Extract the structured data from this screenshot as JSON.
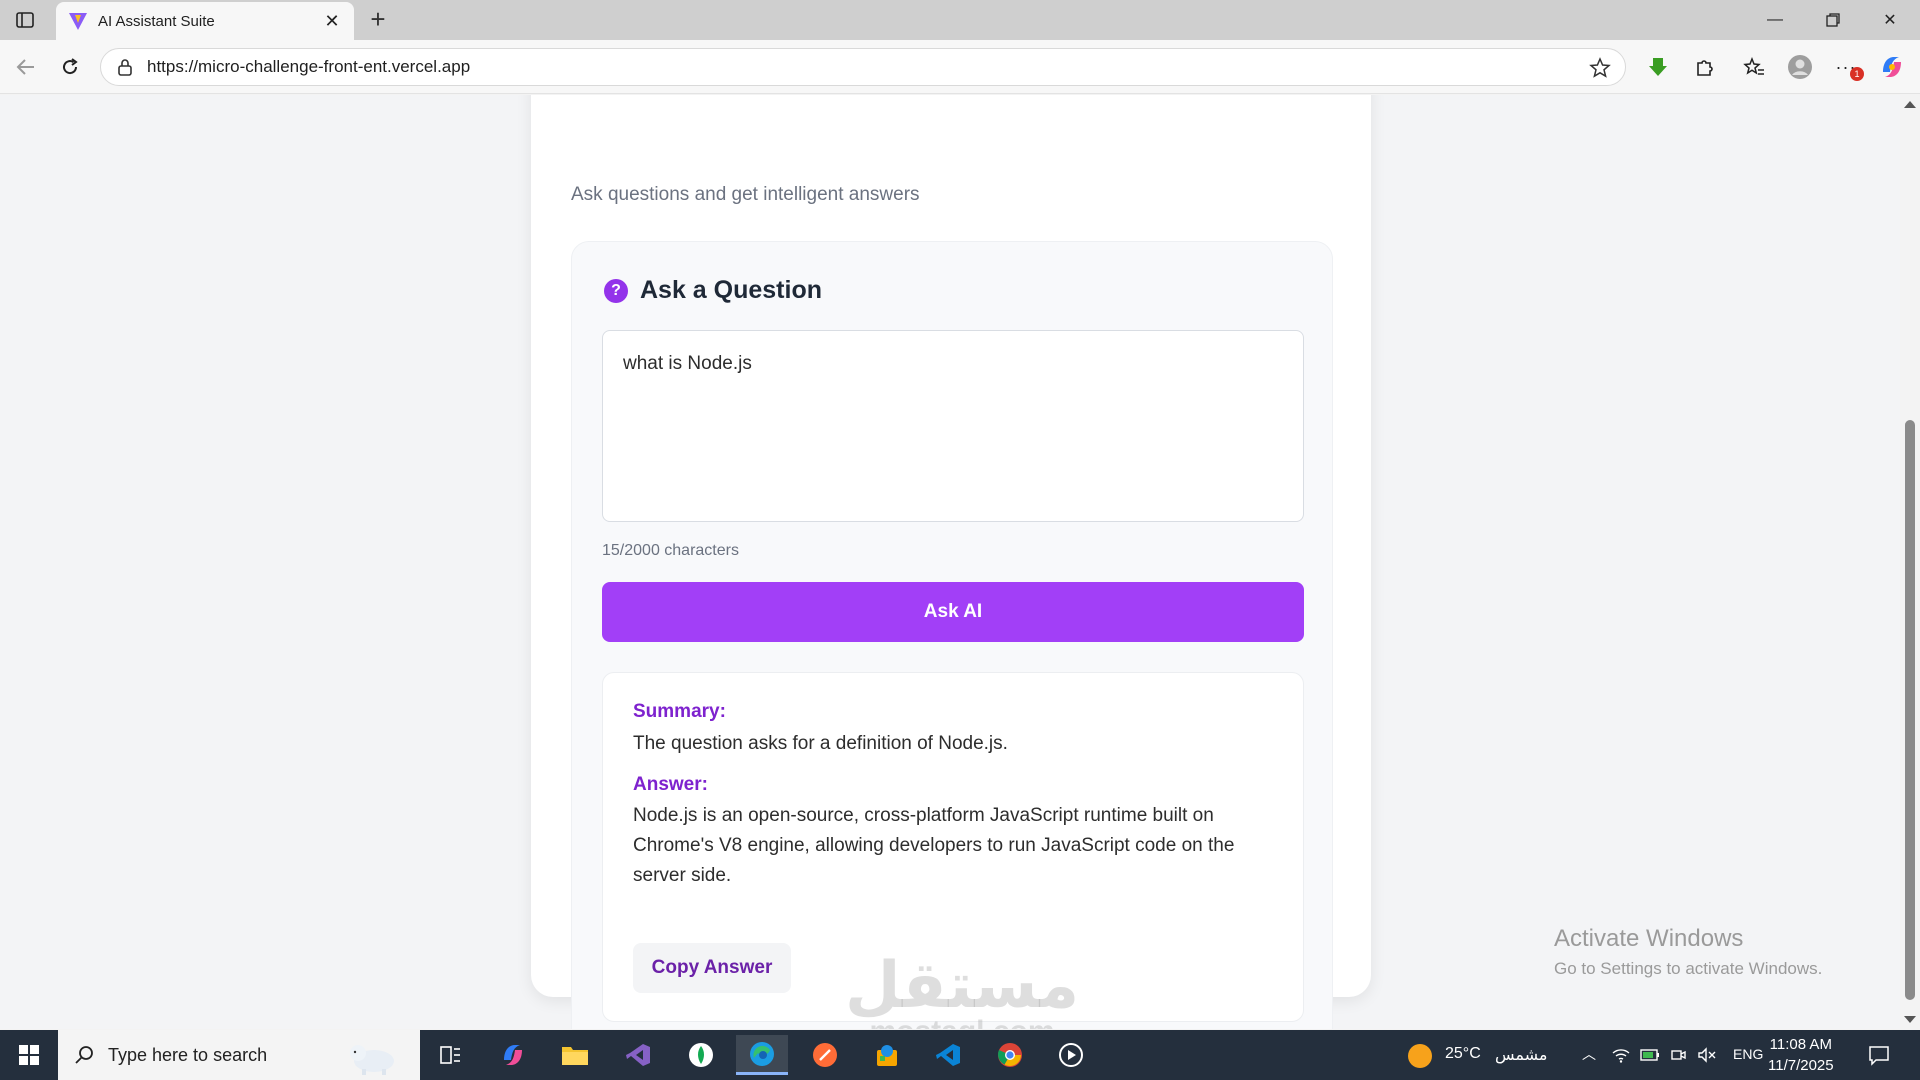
{
  "browser": {
    "tab_title": "AI Assistant Suite",
    "url": "https://micro-challenge-front-ent.vercel.app"
  },
  "page": {
    "subtitle": "Ask questions and get intelligent answers",
    "ask_title": "Ask a Question",
    "question_icon_glyph": "?",
    "question_value": "what is Node.js",
    "char_count": "15/2000 characters",
    "ask_button": "Ask AI",
    "summary_label": "Summary:",
    "summary_text": "The question asks for a definition of Node.js.",
    "answer_label": "Answer:",
    "answer_text": "Node.js is an open-source, cross-platform JavaScript runtime built on Chrome's V8 engine, allowing developers to run JavaScript code on the server side.",
    "copy_button": "Copy Answer",
    "accent_color": "#a23ff7"
  },
  "overlay": {
    "activate_title": "Activate Windows",
    "activate_sub": "Go to Settings to activate Windows.",
    "watermark_ar": "مستقل",
    "watermark_en": "mostaql.com"
  },
  "taskbar": {
    "search_placeholder": "Type here to search",
    "weather": "25°C",
    "weather_label": "مشمس",
    "lang": "ENG",
    "time": "11:08 AM",
    "date": "11/7/2025",
    "notification_count": "1"
  }
}
